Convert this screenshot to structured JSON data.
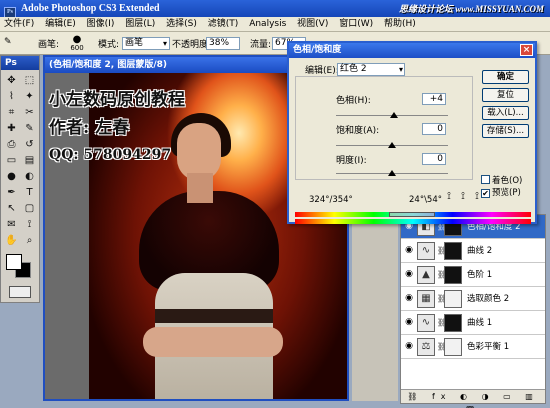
{
  "app": {
    "title": "Adobe Photoshop CS3 Extended",
    "icon_text": "Ps",
    "watermark": "思缘设计论坛 www.MISSYUAN.COM"
  },
  "menu": [
    "文件(F)",
    "编辑(E)",
    "图像(I)",
    "图层(L)",
    "选择(S)",
    "滤镜(T)",
    "Analysis",
    "视图(V)",
    "窗口(W)",
    "帮助(H)"
  ],
  "options": {
    "brush_label": "画笔:",
    "brush_size": "600",
    "mode_label": "模式:",
    "mode_value": "画笔",
    "opacity_label": "不透明度:",
    "opacity_value": "38%",
    "flow_label": "流量:",
    "flow_value": "67%"
  },
  "toolbox": {
    "logo": "Ps",
    "tools": [
      "move-icon",
      "marquee-icon",
      "lasso-icon",
      "magic-wand-icon",
      "crop-icon",
      "slice-icon",
      "healing-icon",
      "brush-icon",
      "stamp-icon",
      "history-brush-icon",
      "eraser-icon",
      "gradient-icon",
      "blur-icon",
      "dodge-icon",
      "pen-icon",
      "type-icon",
      "path-select-icon",
      "shape-icon",
      "notes-icon",
      "eyedropper-icon",
      "hand-icon",
      "zoom-icon"
    ],
    "tool_glyphs": [
      "✥",
      "⬚",
      "⌇",
      "✦",
      "⌗",
      "✂",
      "✚",
      "✎",
      "⎙",
      "↺",
      "▭",
      "▤",
      "●",
      "◐",
      "✒",
      "T",
      "↖",
      "▢",
      "✉",
      "⟟",
      "✋",
      "⌕"
    ]
  },
  "document": {
    "title": "(色相/饱和度 2, 图层蒙版/8)",
    "overlay_lines": [
      "小左数码原创教程",
      "作者: 左春",
      "QQ: 578094297"
    ]
  },
  "dialog": {
    "title": "色相/饱和度",
    "close_glyph": "×",
    "edit_label": "编辑(E):",
    "edit_value": "红色 2",
    "hue_label": "色相(H):",
    "hue_value": "+4",
    "saturation_label": "饱和度(A):",
    "saturation_value": "0",
    "lightness_label": "明度(I):",
    "lightness_value": "0",
    "ok_label": "确定",
    "cancel_label": "复位",
    "load_label": "载入(L)...",
    "save_label": "存储(S)...",
    "colorize_label": "着色(O)",
    "colorize_checked": false,
    "preview_label": "预览(P)",
    "preview_checked": true,
    "range_left": "324°/354°",
    "range_right": "24°\\54°",
    "slider_positions": {
      "hue": 0.52,
      "saturation": 0.5,
      "lightness": 0.5
    }
  },
  "layers": {
    "items": [
      {
        "name": "色相/饱和度 2",
        "icon": "adjustment-icon",
        "glyph": "◧",
        "mask": "dark",
        "selected": true
      },
      {
        "name": "曲线 2",
        "icon": "curves-icon",
        "glyph": "∿",
        "mask": "dark",
        "selected": false
      },
      {
        "name": "色阶 1",
        "icon": "levels-icon",
        "glyph": "▲",
        "mask": "dark",
        "selected": false
      },
      {
        "name": "选取颜色 2",
        "icon": "selective-color-icon",
        "glyph": "▦",
        "mask": "light",
        "selected": false
      },
      {
        "name": "曲线 1",
        "icon": "curves-icon",
        "glyph": "∿",
        "mask": "dark",
        "selected": false
      },
      {
        "name": "色彩平衡 1",
        "icon": "color-balance-icon",
        "glyph": "⚖",
        "mask": "light",
        "selected": false
      }
    ],
    "bottom_icons": "⛓ fx ◐ ◑ ▭ ▥ 🗑"
  },
  "colors": {
    "titlebar": "#1546b8",
    "selection": "#3169c6",
    "dialog_bg": "#ece9d8"
  }
}
